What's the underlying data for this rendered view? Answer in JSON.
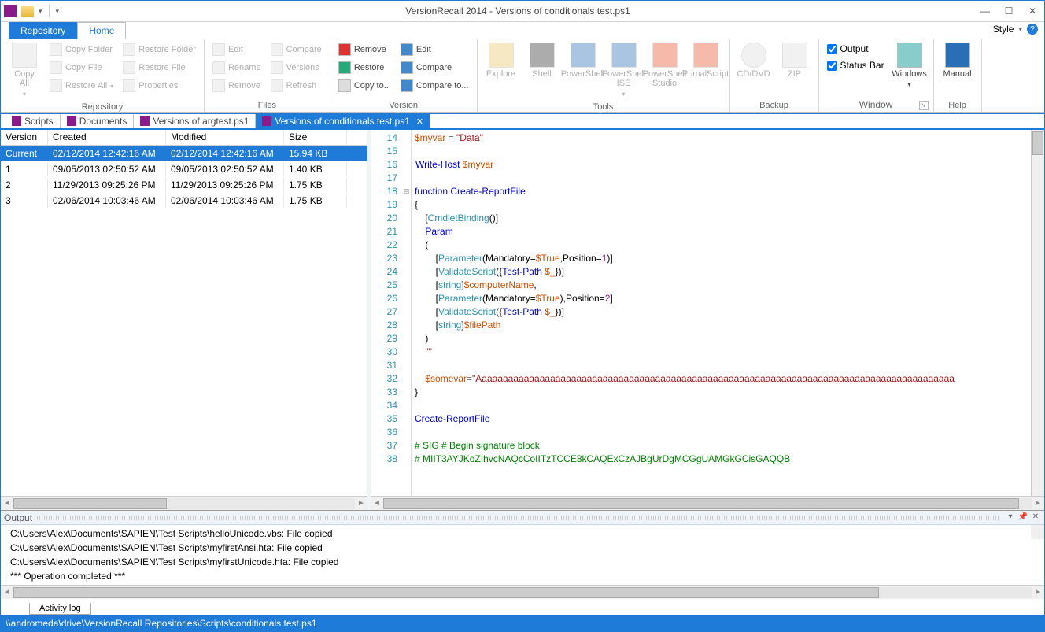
{
  "title": "VersionRecall 2014 - Versions of conditionals test.ps1",
  "style_label": "Style",
  "tabs": {
    "file": "Repository",
    "home": "Home"
  },
  "ribbon": {
    "repository": {
      "title": "Repository",
      "copy_all": "Copy\nAll",
      "copy_folder": "Copy Folder",
      "copy_file": "Copy File",
      "restore_all": "Restore All",
      "restore_folder": "Restore Folder",
      "restore_file": "Restore File",
      "properties": "Properties"
    },
    "files": {
      "title": "Files",
      "edit": "Edit",
      "rename": "Rename",
      "remove": "Remove",
      "compare": "Compare",
      "versions": "Versions",
      "refresh": "Refresh"
    },
    "version": {
      "title": "Version",
      "remove": "Remove",
      "restore": "Restore",
      "copy_to": "Copy to...",
      "edit": "Edit",
      "compare": "Compare",
      "compare_to": "Compare to..."
    },
    "tools": {
      "title": "Tools",
      "explore": "Explore",
      "shell": "Shell",
      "powershell": "PowerShell",
      "ise": "PowerShell\nISE",
      "studio": "PowerShell\nStudio",
      "primal": "PrimalScript"
    },
    "backup": {
      "title": "Backup",
      "cd": "CD/DVD",
      "zip": "ZIP"
    },
    "window": {
      "title": "Window",
      "windows": "Windows",
      "output": "Output",
      "statusbar": "Status Bar"
    },
    "help": {
      "title": "Help",
      "manual": "Manual"
    }
  },
  "doc_tabs": [
    {
      "label": "Scripts"
    },
    {
      "label": "Documents"
    },
    {
      "label": "Versions of argtest.ps1"
    },
    {
      "label": "Versions of conditionals test.ps1",
      "active": true
    }
  ],
  "grid": {
    "headers": {
      "version": "Version",
      "created": "Created",
      "modified": "Modified",
      "size": "Size"
    },
    "rows": [
      {
        "version": "Current",
        "created": "02/12/2014 12:42:16 AM",
        "modified": "02/12/2014 12:42:16 AM",
        "size": "15.94 KB",
        "sel": true
      },
      {
        "version": "1",
        "created": "09/05/2013 02:50:52 AM",
        "modified": "09/05/2013 02:50:52 AM",
        "size": "1.40 KB"
      },
      {
        "version": "2",
        "created": "11/29/2013 09:25:26 PM",
        "modified": "11/29/2013 09:25:26 PM",
        "size": "1.75 KB"
      },
      {
        "version": "3",
        "created": "02/06/2014 10:03:46 AM",
        "modified": "02/06/2014 10:03:46 AM",
        "size": "1.75 KB"
      }
    ]
  },
  "code_start_line": 14,
  "output": {
    "title": "Output",
    "lines": [
      "C:\\Users\\Alex\\Documents\\SAPIEN\\Test Scripts\\helloUnicode.vbs: File copied",
      "C:\\Users\\Alex\\Documents\\SAPIEN\\Test Scripts\\myfirstAnsi.hta: File copied",
      "C:\\Users\\Alex\\Documents\\SAPIEN\\Test Scripts\\myfirstUnicode.hta: File copied",
      "*** Operation completed ***"
    ]
  },
  "bottom_tab": "Activity log",
  "status": "\\\\andromeda\\drive\\VersionRecall Repositories\\Scripts\\conditionals test.ps1"
}
